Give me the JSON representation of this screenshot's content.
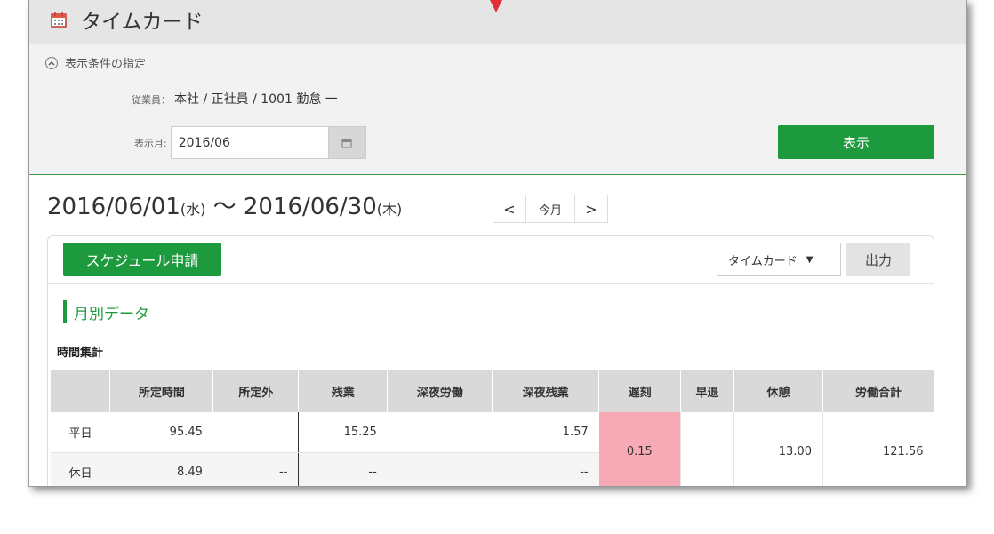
{
  "header": {
    "title": "タイムカード",
    "icon": "calendar-icon"
  },
  "conditions": {
    "toggle_label": "表示条件の指定",
    "employee_label": "従業員：",
    "employee_value": "本社 / 正社員 / 1001 勤怠 一",
    "month_label": "表示月:",
    "month_value": "2016/06",
    "show_button": "表示"
  },
  "range": {
    "start": "2016/06/01",
    "start_dow": "(水)",
    "sep": " ～ ",
    "end": "2016/06/30",
    "end_dow": "(木)"
  },
  "nav": {
    "prev": "<",
    "current": "今月",
    "next": ">"
  },
  "toolbar": {
    "schedule_button": "スケジュール申請",
    "select_value": "タイムカード",
    "output_button": "出力"
  },
  "section": {
    "title": "月別データ",
    "subtitle": "時間集計"
  },
  "table": {
    "headers": [
      "",
      "所定時間",
      "所定外",
      "残業",
      "深夜労働",
      "深夜残業",
      "遅刻",
      "早退",
      "休憩",
      "労働合計"
    ],
    "rows": [
      {
        "label": "平日",
        "shotei": "95.45",
        "shoteigai": "",
        "zangyo": "15.25",
        "shinya": "",
        "shinya_zan": "1.57"
      },
      {
        "label": "休日",
        "shotei": "8.49",
        "shoteigai": "--",
        "zangyo": "--",
        "shinya": "",
        "shinya_zan": "--"
      }
    ],
    "merged": {
      "chikoku": "0.15",
      "soutai": "",
      "kyukei": "13.00",
      "total": "121.56"
    }
  },
  "colors": {
    "accent": "#1d9a3e",
    "highlight": "#f7aab6",
    "arrow": "#e0303a"
  }
}
